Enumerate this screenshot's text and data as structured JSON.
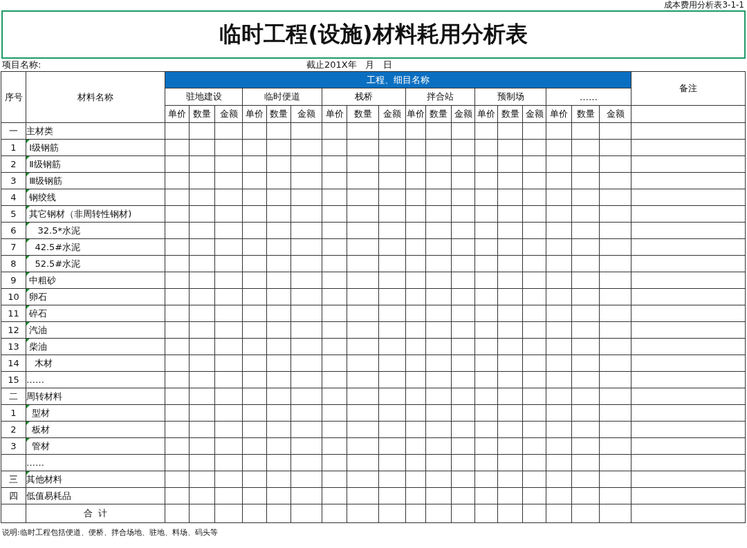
{
  "form_code": "成本费用分析表3-1-1",
  "title": "临时工程(设施)材料耗用分析表",
  "project_label": "项目名称:",
  "date_label": "截止201X年   月   日",
  "header": {
    "seq": "序号",
    "material": "材料名称",
    "group_title": "工程、细目名称",
    "remark": "备注",
    "groups": [
      {
        "name": "驻地建设",
        "sub": [
          "单价",
          "数量",
          "金额"
        ]
      },
      {
        "name": "临时便道",
        "sub": [
          "单价",
          "数量",
          "金额"
        ]
      },
      {
        "name": "栈桥",
        "sub": [
          "单价",
          "数量",
          "金额"
        ]
      },
      {
        "name": "拌合站",
        "sub": [
          "单价",
          "数量",
          "金额"
        ]
      },
      {
        "name": "预制场",
        "sub": [
          "单价",
          "数量",
          "金额"
        ]
      },
      {
        "name": "……",
        "sub": [
          "单价",
          "数量",
          "金额"
        ]
      }
    ]
  },
  "rows": [
    {
      "seq": "一",
      "name": "主材类",
      "marked": false
    },
    {
      "seq": "1",
      "name": " Ⅰ级钢筋",
      "marked": true
    },
    {
      "seq": "2",
      "name": " Ⅱ级钢筋",
      "marked": true
    },
    {
      "seq": "3",
      "name": " Ⅲ级钢筋",
      "marked": true
    },
    {
      "seq": "4",
      "name": " 钢绞线",
      "marked": true
    },
    {
      "seq": "5",
      "name": " 其它钢材（非周转性钢材)",
      "marked": true
    },
    {
      "seq": "6",
      "name": "    32.5*水泥",
      "marked": true
    },
    {
      "seq": "7",
      "name": "   42.5#水泥",
      "marked": true
    },
    {
      "seq": "8",
      "name": "   52.5#水泥",
      "marked": true
    },
    {
      "seq": "9",
      "name": " 中粗砂",
      "marked": true
    },
    {
      "seq": "10",
      "name": " 卵石",
      "marked": true
    },
    {
      "seq": "11",
      "name": " 碎石",
      "marked": true
    },
    {
      "seq": "12",
      "name": " 汽油",
      "marked": true
    },
    {
      "seq": "13",
      "name": " 柴油",
      "marked": true
    },
    {
      "seq": "14",
      "name": "   木材",
      "marked": false
    },
    {
      "seq": "15",
      "name": "……",
      "marked": false
    },
    {
      "seq": "二",
      "name": "周转材料",
      "marked": false
    },
    {
      "seq": "1",
      "name": "  型材",
      "marked": true
    },
    {
      "seq": "2",
      "name": "  板材",
      "marked": true
    },
    {
      "seq": "3",
      "name": "  管材",
      "marked": true
    },
    {
      "name": "……",
      "marked": false
    },
    {
      "seq": "三",
      "name": "其他材料",
      "marked": true
    },
    {
      "seq": "四",
      "name": "低值易耗品",
      "marked": false
    }
  ],
  "total_label": "合  计",
  "note": "说明:临时工程包括便道、便桥、拌合场地、驻地、料场、码头等"
}
